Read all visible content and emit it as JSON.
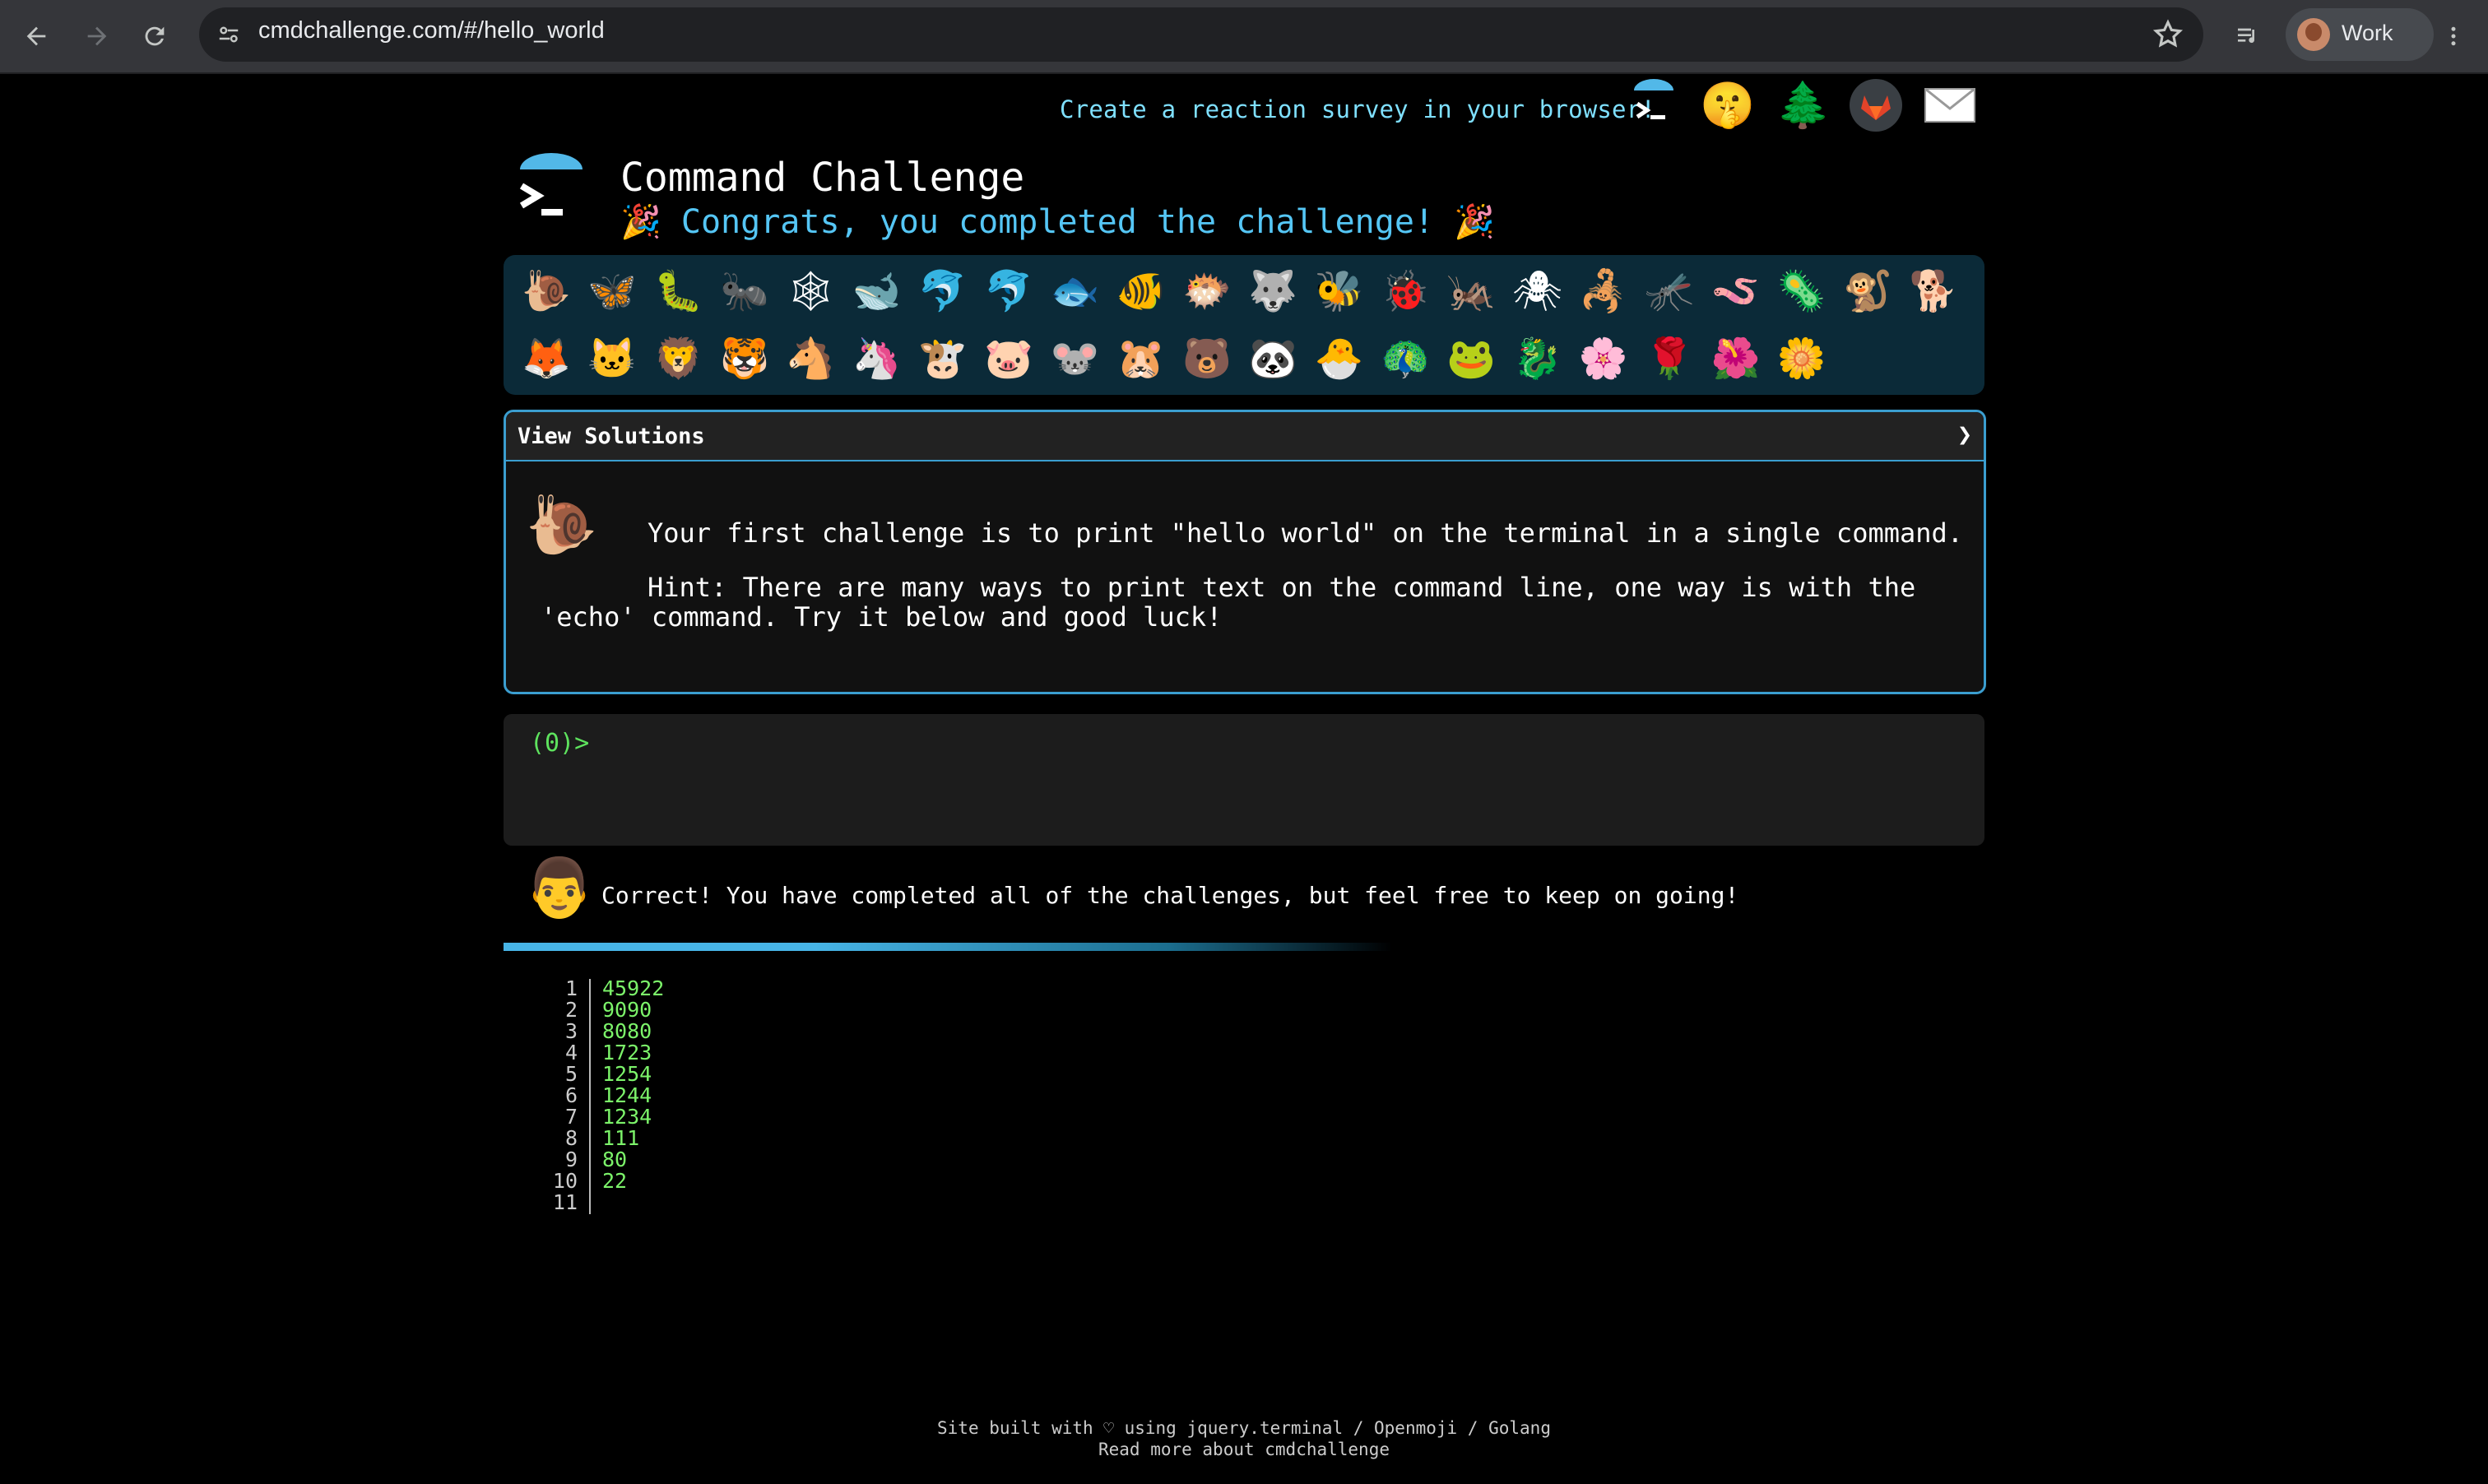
{
  "browser": {
    "url": "cmdchallenge.com/#/hello_world",
    "profile_label": "Work"
  },
  "header": {
    "survey_link": "Create a reaction survey in your browser!",
    "title": "Command Challenge",
    "congrats": "🎉 Congrats, you completed the challenge! 🎉",
    "top_icons": [
      {
        "name": "reaction-survey-icon",
        "glyph": "▶_"
      },
      {
        "name": "shushing-face-icon",
        "glyph": "🤫"
      },
      {
        "name": "tree-icon",
        "glyph": "🌲"
      },
      {
        "name": "gitlab-icon",
        "glyph": "🦊"
      },
      {
        "name": "mail-icon",
        "glyph": "✉"
      }
    ]
  },
  "badges": {
    "row1": [
      "🐌",
      "🦋",
      "🐛",
      "🐜",
      "🕸",
      "🐋",
      "🐬",
      "🐬",
      "🐟",
      "🐠",
      "🐡",
      "🐺",
      "🐝",
      "🐞",
      "🦗",
      "🕷",
      "🦂",
      "🦟",
      "🪱",
      "🦠",
      "🐒",
      "🐕"
    ],
    "row2": [
      "🦊",
      "🐱",
      "🦁",
      "🐯",
      "🐴",
      "🦄",
      "🐮",
      "🐷",
      "🐭",
      "🐹",
      "🐻",
      "🐼",
      "🐣",
      "🦚",
      "🐸",
      "🐉",
      "🌸",
      "🌹",
      "🌺",
      "🌼"
    ]
  },
  "solutions": {
    "title": "View Solutions",
    "chevron": "❯",
    "challenge_icon": "🐌",
    "line1": "Your first challenge is to print \"hello world\" on the terminal in a single command.",
    "hint_line1": "Hint: There are many ways to print text on the command line, one way is with the",
    "hint_line2": "'echo' command. Try it below and good luck!"
  },
  "terminal": {
    "prompt": "(0)>"
  },
  "result": {
    "avatar_icon": "👨",
    "message": "Correct! You have completed all of the challenges, but feel free to keep on going!",
    "progress_fraction": 1.0
  },
  "output_lines": [
    {
      "n": "1",
      "v": "45922"
    },
    {
      "n": "2",
      "v": "9090"
    },
    {
      "n": "3",
      "v": "8080"
    },
    {
      "n": "4",
      "v": "1723"
    },
    {
      "n": "5",
      "v": "1254"
    },
    {
      "n": "6",
      "v": "1244"
    },
    {
      "n": "7",
      "v": "1234"
    },
    {
      "n": "8",
      "v": "111"
    },
    {
      "n": "9",
      "v": "80"
    },
    {
      "n": "10",
      "v": "22"
    },
    {
      "n": "11",
      "v": ""
    }
  ],
  "footer": {
    "line1": "Site built with ♡ using jquery.terminal / Openmoji / Golang",
    "line2": "Read more about cmdchallenge"
  },
  "colors": {
    "accent": "#3b9ed0",
    "prompt": "#5ee35e",
    "output": "#7cf36a",
    "congrats": "#55c6f5"
  }
}
